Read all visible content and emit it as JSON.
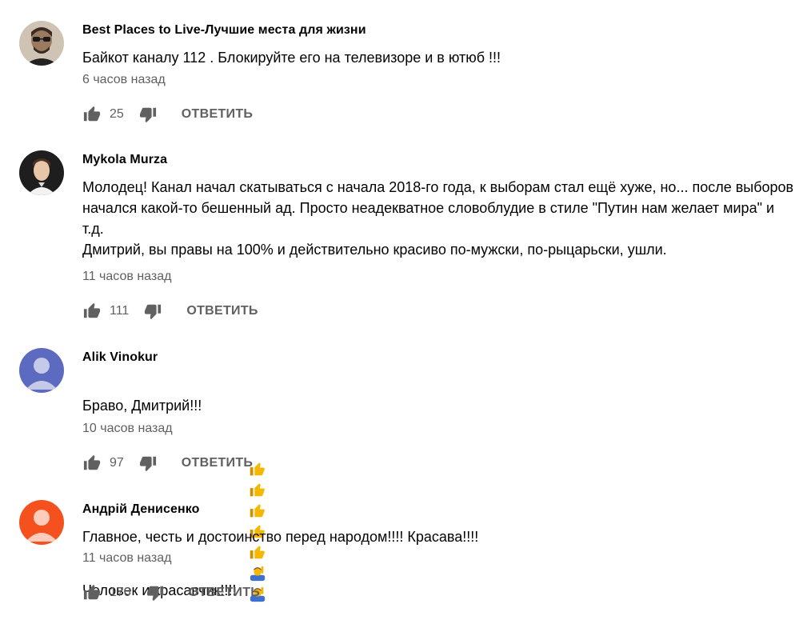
{
  "comments": [
    {
      "author": "Best Places to Live-Лучшие места для жизни",
      "text": "Байкот каналу 112 . Блокируйте его на телевизоре и в ютюб !!!",
      "time": "6 часов назад",
      "likes": "25",
      "reply_label": "ОТВЕТИТЬ",
      "avatar_color": "#b9a58c"
    },
    {
      "author": "Mykola Murza",
      "text": "Молодец! Канал начал скатываться с начала 2018-го года, к выборам стал ещё хуже, но... после выборов начался какой-то бешенный ад. Просто неадекватное словоблудие в стиле \"Путин нам желает мира\" и т.д.\nДмитрий, вы правы на 100% и действительно красиво по-мужски, по-рыцарьски, ушли.",
      "time": "11 часов назад",
      "likes": "111",
      "reply_label": "ОТВЕТИТЬ",
      "avatar_color": "#2b2b2b"
    },
    {
      "author": "Alik Vinokur",
      "text_line1": "Браво, Дмитрий!!!",
      "text_line2": "Человек  и красавчик!!!!",
      "emojis": [
        "thumbs-up",
        "thumbs-up",
        "thumbs-up",
        "thumbs-up",
        "thumbs-up",
        "person-raising-hand",
        "person-raising-hand"
      ],
      "time": "10 часов назад",
      "likes": "97",
      "reply_label": "ОТВЕТИТЬ",
      "avatar_color": "#5c6bc0"
    },
    {
      "author": "Андрій Денисенко",
      "text": "Главное, честь и достоинство перед народом!!!! Красава!!!!",
      "time": "11 часов назад",
      "likes": "170",
      "reply_label": "ОТВЕТИТЬ",
      "avatar_color": "#f4511e"
    }
  ],
  "colors": {
    "text_primary": "#030303",
    "text_secondary": "#606060",
    "icon": "#606060"
  }
}
